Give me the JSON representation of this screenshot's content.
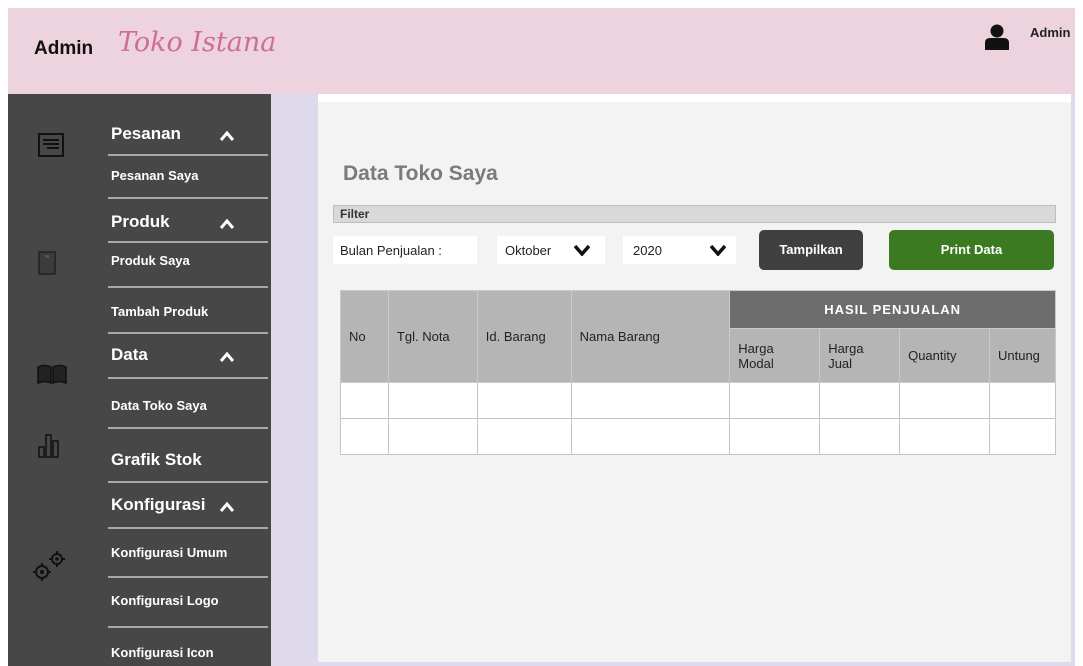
{
  "header": {
    "brand_admin": "Admin",
    "brand_name": "Toko Istana",
    "user_name": "Admin",
    "user_icon": "user-icon",
    "brand_color": "#cf6c9a",
    "background": "#ecd3de"
  },
  "sidebar": {
    "background": "#474747",
    "sections": {
      "pesanan": {
        "label": "Pesanan",
        "icon": "document-icon",
        "items": [
          "Pesanan Saya"
        ]
      },
      "produk": {
        "label": "Produk",
        "icon": "phone-icon",
        "items": [
          "Produk Saya",
          "Tambah Produk"
        ]
      },
      "data": {
        "label": "Data",
        "icon": "book-icon",
        "items": [
          "Data Toko Saya"
        ]
      },
      "grafik": {
        "label": "Grafik Stok",
        "icon": "bar-chart-icon"
      },
      "konfigurasi": {
        "label": "Konfigurasi",
        "icon": "gears-icon",
        "items": [
          "Konfigurasi Umum",
          "Konfigurasi Logo",
          "Konfigurasi Icon"
        ]
      }
    }
  },
  "main": {
    "title": "Data Toko Saya",
    "filter": {
      "title": "Filter",
      "month_label": "Bulan Penjualan :",
      "month_value": "Oktober",
      "year_value": "2020"
    },
    "buttons": {
      "show": "Tampilkan",
      "print": "Print Data",
      "show_color": "#404040",
      "print_color": "#3c7a22"
    },
    "table": {
      "group_header": "HASIL PENJUALAN",
      "columns": {
        "no": "No",
        "tgl_nota": "Tgl. Nota",
        "id_barang": "Id. Barang",
        "nama_barang": "Nama Barang",
        "harga_modal": "Harga Modal",
        "harga_jual": "Harga Jual",
        "quantity": "Quantity",
        "untung": "Untung"
      },
      "rows": [
        [
          "",
          "",
          "",
          "",
          "",
          "",
          "",
          ""
        ],
        [
          "",
          "",
          "",
          "",
          "",
          "",
          "",
          ""
        ]
      ]
    }
  }
}
